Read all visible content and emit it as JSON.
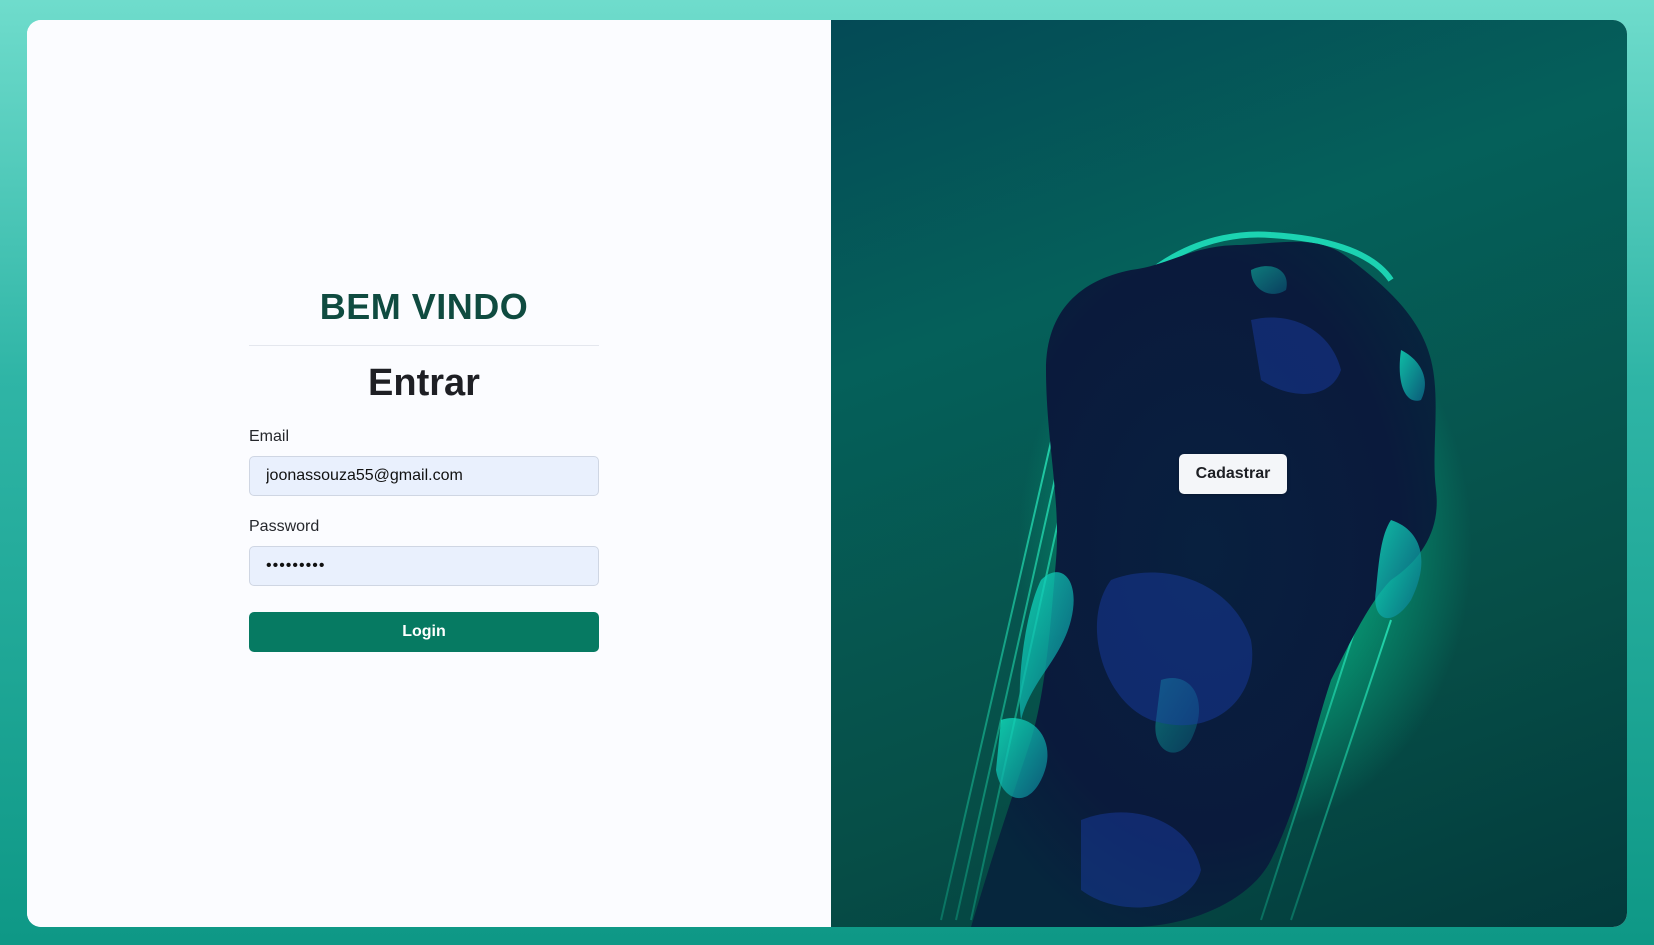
{
  "left_panel": {
    "welcome": "BEM VINDO",
    "title": "Entrar",
    "email_label": "Email",
    "email_value": "joonassouza55@gmail.com",
    "password_label": "Password",
    "password_value": "•••••••••",
    "login_label": "Login"
  },
  "right_panel": {
    "signup_label": "Cadastrar",
    "image_icon": "abstract-sculpture-illustration"
  },
  "colors": {
    "accent": "#067a62",
    "heading": "#0f4b40",
    "background_gradient_top": "#6fdccc",
    "background_gradient_bottom": "#0e9886"
  }
}
